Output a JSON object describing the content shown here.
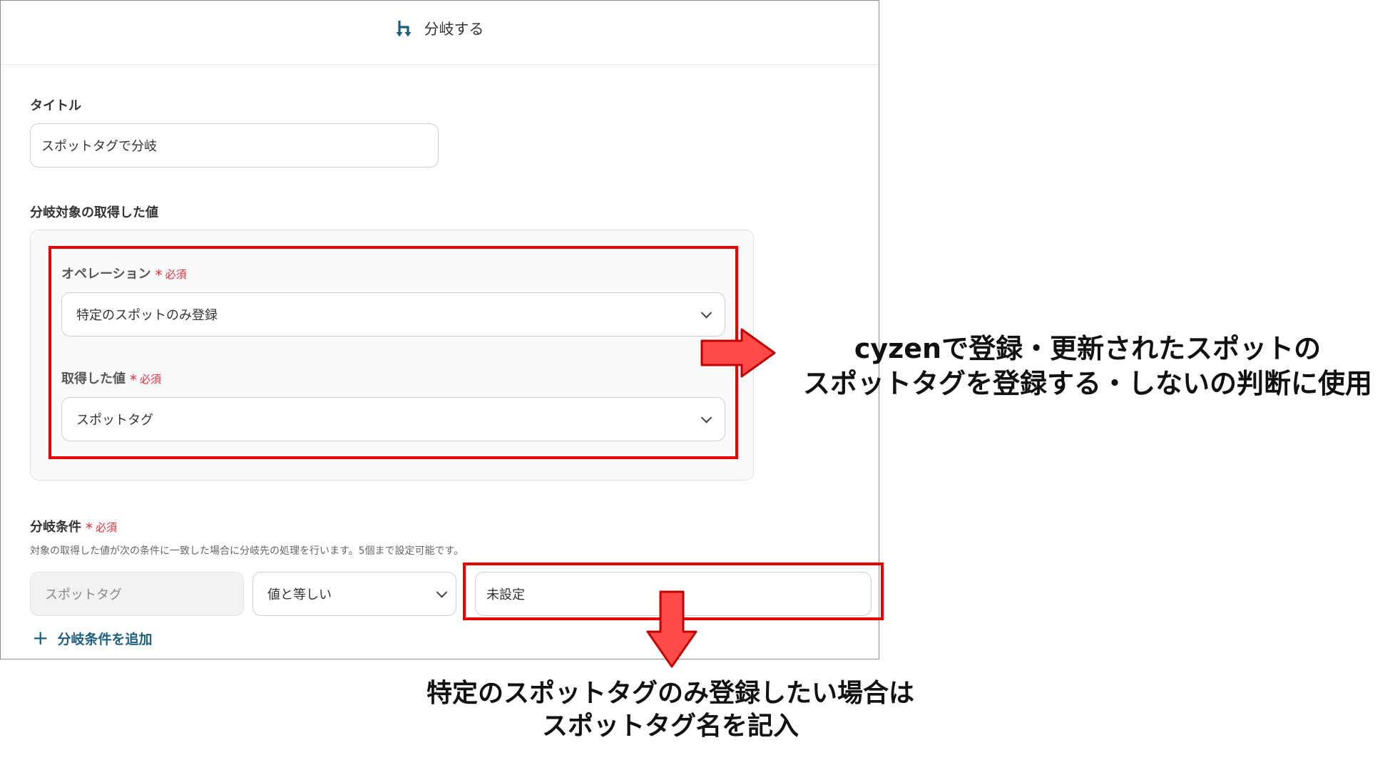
{
  "header": {
    "title": "分岐する",
    "icon": "branch-icon"
  },
  "title_field": {
    "label": "タイトル",
    "value": "スポットタグで分岐"
  },
  "target_section": {
    "label": "分岐対象の取得した値",
    "operation": {
      "label": "オペレーション",
      "required": "必須",
      "value": "特定のスポットのみ登録"
    },
    "acquired_value": {
      "label": "取得した値",
      "required": "必須",
      "value": "スポットタグ"
    }
  },
  "condition_section": {
    "label": "分岐条件",
    "required": "必須",
    "help": "対象の取得した値が次の条件に一致した場合に分岐先の処理を行います。5個まで設定可能です。",
    "field": "スポットタグ",
    "operator": "値と等しい",
    "value": "未設定",
    "add_label": "分岐条件を追加"
  },
  "annotations": {
    "right_line1": "cyzenで登録・更新されたスポットの",
    "right_line2": "スポットタグを登録する・しないの判断に使用",
    "bottom_line1": "特定のスポットタグのみ登録したい場合は",
    "bottom_line2": "スポットタグ名を記入"
  },
  "colors": {
    "accent": "#1e5f7d",
    "required": "#e0303a",
    "highlight": "#e60000",
    "arrow_fill": "#ff4a4a"
  }
}
